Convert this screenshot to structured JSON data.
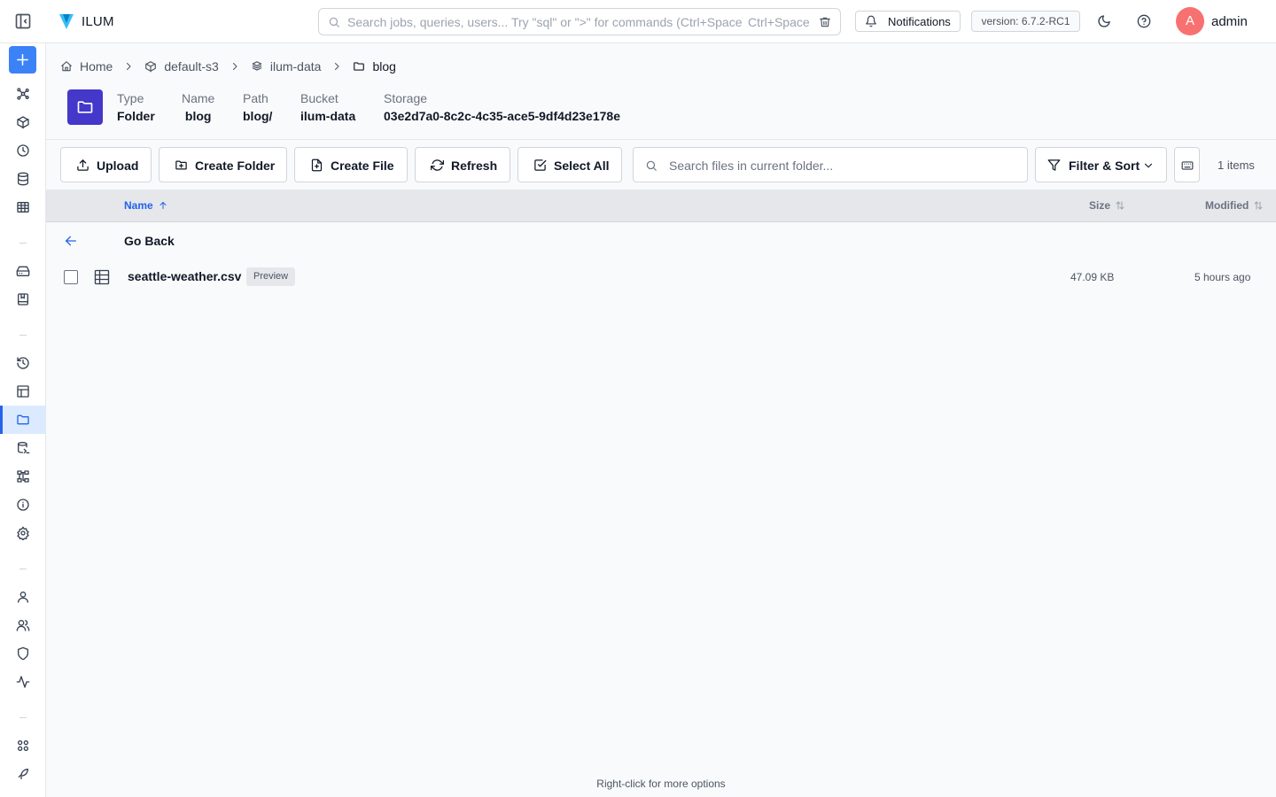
{
  "app": {
    "brand": "ILUM",
    "accent": "#3b82f6",
    "brand_folder_color": "#4338ca"
  },
  "topbar": {
    "search_placeholder": "Search jobs, queries, users... Try \"sql\" or \">\" for commands (Ctrl+Space)",
    "search_shortcut": "Ctrl+Space",
    "notifications_label": "Notifications",
    "version": "version: 6.7.2-RC1",
    "user_initial": "A",
    "user_name": "admin"
  },
  "breadcrumb": [
    {
      "label": "Home",
      "icon": "home-icon"
    },
    {
      "label": "default-s3",
      "icon": "box-icon"
    },
    {
      "label": "ilum-data",
      "icon": "bucket-icon"
    },
    {
      "label": "blog",
      "icon": "folder-icon"
    }
  ],
  "info": {
    "type": {
      "label": "Type",
      "value": "Folder"
    },
    "name": {
      "label": "Name",
      "value": "blog"
    },
    "path": {
      "label": "Path",
      "value": "blog/"
    },
    "bucket": {
      "label": "Bucket",
      "value": "ilum-data"
    },
    "storage": {
      "label": "Storage",
      "value": "03e2d7a0-8c2c-4c35-ace5-9df4d23e178e"
    }
  },
  "toolbar": {
    "upload": "Upload",
    "create_folder": "Create Folder",
    "create_file": "Create File",
    "refresh": "Refresh",
    "select_all": "Select All",
    "search_placeholder": "Search files in current folder...",
    "filter_sort": "Filter & Sort",
    "item_count": "1 items"
  },
  "table": {
    "columns": {
      "name": "Name",
      "size": "Size",
      "modified": "Modified"
    },
    "go_back": "Go Back",
    "rows": [
      {
        "name": "seattle-weather.csv",
        "badge": "Preview",
        "size": "47.09 KB",
        "modified": "5 hours ago"
      }
    ]
  },
  "footer_hint": "Right-click for more options",
  "sidebar_icons": [
    "network-icon",
    "cube-icon",
    "clock-icon",
    "database-icon",
    "table-icon",
    "drive-icon",
    "notebook-icon",
    "history-icon",
    "layout-icon",
    "folder-icon",
    "sql-icon",
    "lineage-icon",
    "info-icon",
    "settings-icon",
    "user-icon",
    "users-icon",
    "shield-icon",
    "activity-icon",
    "modules-icon",
    "feather-icon"
  ]
}
